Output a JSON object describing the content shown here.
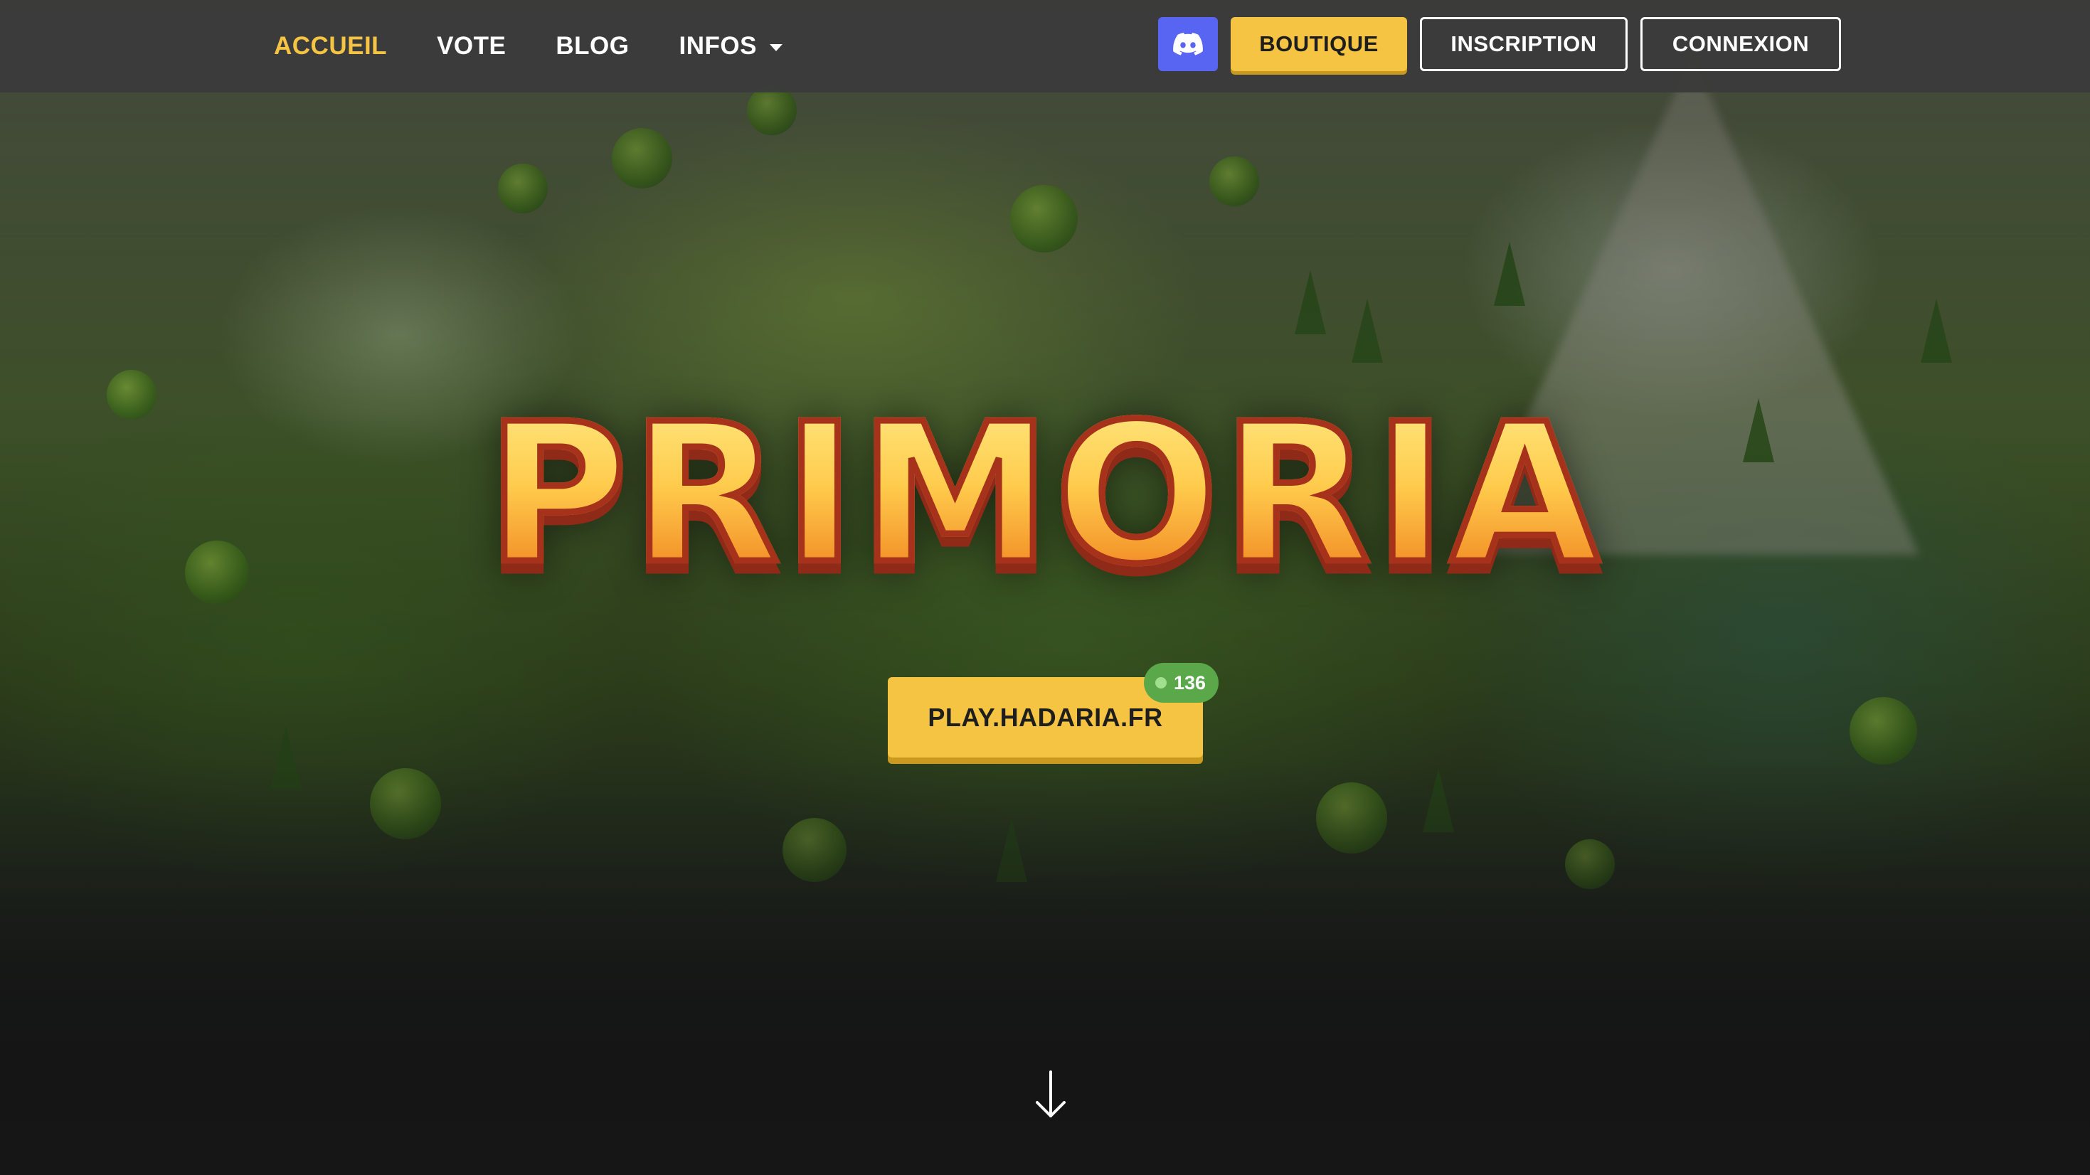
{
  "nav": {
    "links": [
      {
        "label": "ACCUEIL",
        "active": true
      },
      {
        "label": "VOTE",
        "active": false
      },
      {
        "label": "BLOG",
        "active": false
      },
      {
        "label": "INFOS",
        "active": false,
        "dropdown": true
      }
    ],
    "discord_icon": "discord-icon",
    "shop_label": "BOUTIQUE",
    "register_label": "INSCRIPTION",
    "login_label": "CONNEXION"
  },
  "hero": {
    "logo_text": "PRIMORIA",
    "server_ip": "PLAY.HADARIA.FR",
    "online_count": "136",
    "scroll_icon": "arrow-down-icon"
  },
  "colors": {
    "accent": "#f5c443",
    "discord": "#5865f2",
    "online_badge": "#5aa84a",
    "navbar": "#3a3a3a"
  }
}
